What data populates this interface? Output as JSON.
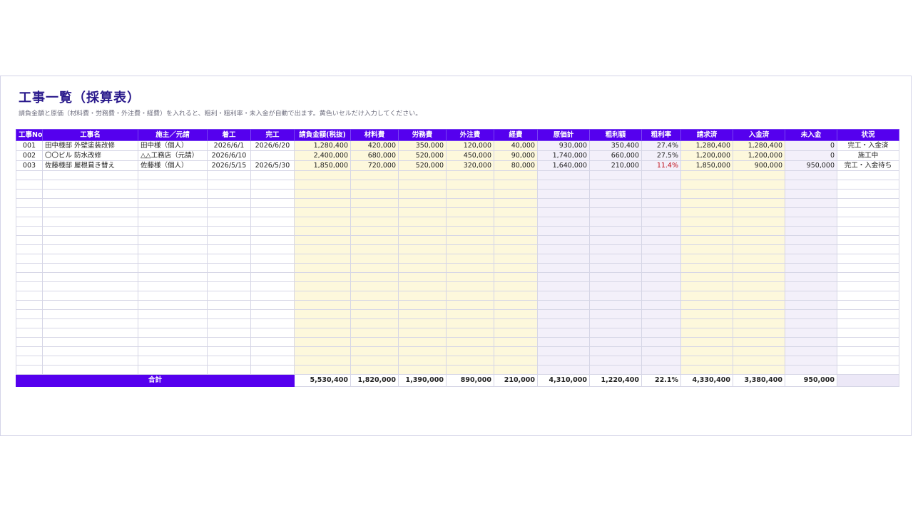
{
  "sheet": {
    "title": "工事一覧（採算表）",
    "subtitle": "請負金額と原価（材料費・労務費・外注費・経費）を入れると、粗利・粗利率・未入金が自動で出ます。黄色いセルだけ入力してください。"
  },
  "colors": {
    "header_bg": "#5500ee",
    "input_cell": "#fdf8dc",
    "calc_cell": "#f3f0fa",
    "title": "#2a1a8c",
    "negative_rate": "#c0101a"
  },
  "columns": [
    "工事No",
    "工事名",
    "施主／元請",
    "着工",
    "完工",
    "請負金額(税抜)",
    "材料費",
    "労務費",
    "外注費",
    "経費",
    "原価計",
    "粗利額",
    "粗利率",
    "請求済",
    "入金済",
    "未入金",
    "状況"
  ],
  "rows": [
    {
      "no": "001",
      "name": "田中様邸 外壁塗装改修",
      "client": "田中様（個人）",
      "start": "2026/6/1",
      "end": "2026/6/20",
      "contract": "1,280,400",
      "material": "420,000",
      "labor": "350,000",
      "subcontract": "120,000",
      "expense": "40,000",
      "cost_total": "930,000",
      "gross_profit": "350,400",
      "margin": "27.4%",
      "billed": "1,280,400",
      "received": "1,280,400",
      "unpaid": "0",
      "status": "完工・入金済"
    },
    {
      "no": "002",
      "name": "〇〇ビル 防水改修",
      "client": "△△工務店（元請）",
      "start": "2026/6/10",
      "end": "",
      "contract": "2,400,000",
      "material": "680,000",
      "labor": "520,000",
      "subcontract": "450,000",
      "expense": "90,000",
      "cost_total": "1,740,000",
      "gross_profit": "660,000",
      "margin": "27.5%",
      "billed": "1,200,000",
      "received": "1,200,000",
      "unpaid": "0",
      "status": "施工中"
    },
    {
      "no": "003",
      "name": "佐藤様邸 屋根葺き替え",
      "client": "佐藤様（個人）",
      "start": "2026/5/15",
      "end": "2026/5/30",
      "contract": "1,850,000",
      "material": "720,000",
      "labor": "520,000",
      "subcontract": "320,000",
      "expense": "80,000",
      "cost_total": "1,640,000",
      "gross_profit": "210,000",
      "margin": "11.4%",
      "billed": "1,850,000",
      "received": "900,000",
      "unpaid": "950,000",
      "status": "完工・入金待ち"
    }
  ],
  "totals": {
    "label": "合計",
    "contract": "5,530,400",
    "material": "1,820,000",
    "labor": "1,390,000",
    "subcontract": "890,000",
    "expense": "210,000",
    "cost_total": "4,310,000",
    "gross_profit": "1,220,400",
    "margin": "22.1%",
    "billed": "4,330,400",
    "received": "3,380,400",
    "unpaid": "950,000"
  }
}
